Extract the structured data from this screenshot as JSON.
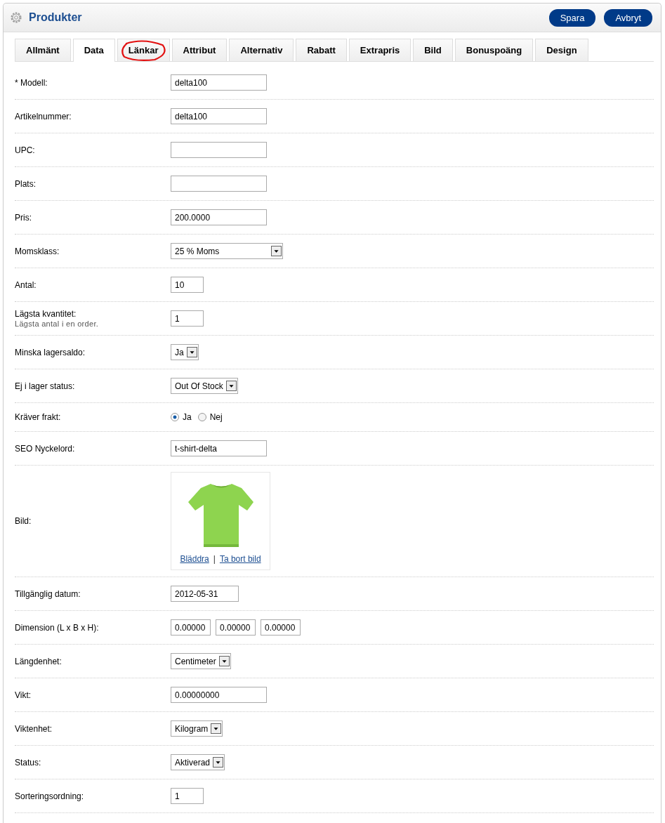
{
  "header": {
    "title": "Produkter",
    "buttons": [
      "Spara",
      "Avbryt"
    ]
  },
  "tabs": [
    {
      "label": "Allmänt",
      "selected": false,
      "circled": false
    },
    {
      "label": "Data",
      "selected": true,
      "circled": false
    },
    {
      "label": "Länkar",
      "selected": false,
      "circled": true
    },
    {
      "label": "Attribut",
      "selected": false,
      "circled": false
    },
    {
      "label": "Alternativ",
      "selected": false,
      "circled": false
    },
    {
      "label": "Rabatt",
      "selected": false,
      "circled": false
    },
    {
      "label": "Extrapris",
      "selected": false,
      "circled": false
    },
    {
      "label": "Bild",
      "selected": false,
      "circled": false
    },
    {
      "label": "Bonuspoäng",
      "selected": false,
      "circled": false
    },
    {
      "label": "Design",
      "selected": false,
      "circled": false
    }
  ],
  "rows": [
    {
      "kind": "text",
      "label": "* Modell:",
      "value": "delta100"
    },
    {
      "kind": "text",
      "label": "Artikelnummer:",
      "value": "delta100"
    },
    {
      "kind": "text",
      "label": "UPC:"
    },
    {
      "kind": "text",
      "label": "Plats:"
    },
    {
      "kind": "text",
      "label": "Pris:",
      "value": "200.0000"
    },
    {
      "kind": "select",
      "label": "Momsklass:",
      "value": "25 % Moms",
      "wide": true
    },
    {
      "kind": "short",
      "label": "Antal:",
      "value": "10"
    },
    {
      "kind": "short",
      "label": "Lägsta kvantitet:",
      "help": "Lägsta antal i en order.",
      "value": "1"
    },
    {
      "kind": "select",
      "label": "Minska lagersaldo:",
      "value": "Ja"
    },
    {
      "kind": "select",
      "label": "Ej i lager status:",
      "value": "Out Of Stock"
    },
    {
      "kind": "radio",
      "label": "Kräver frakt:",
      "options": [
        {
          "label": "Ja",
          "selected": true
        },
        {
          "label": "Nej",
          "selected": false
        }
      ]
    },
    {
      "kind": "text",
      "label": "SEO Nyckelord:",
      "value": "t-shirt-delta"
    },
    {
      "label": "Bild:",
      "links": [
        "Bläddra",
        "Ta bort bild"
      ],
      "separator": "|"
    },
    {
      "kind": "date",
      "label": "Tillgänglig datum:",
      "value": "2012-05-31"
    },
    {
      "kind": "dimension",
      "label": "Dimension (L x B x H):",
      "values": [
        "0.00000",
        "0.00000",
        "0.00000"
      ]
    },
    {
      "kind": "select",
      "label": "Längdenhet:",
      "value": "Centimeter"
    },
    {
      "kind": "text",
      "label": "Vikt:",
      "value": "0.00000000"
    },
    {
      "kind": "select",
      "label": "Viktenhet:",
      "value": "Kilogram"
    },
    {
      "kind": "select",
      "label": "Status:",
      "value": "Aktiverad"
    },
    {
      "kind": "short",
      "label": "Sorteringsordning:",
      "value": "1"
    }
  ]
}
